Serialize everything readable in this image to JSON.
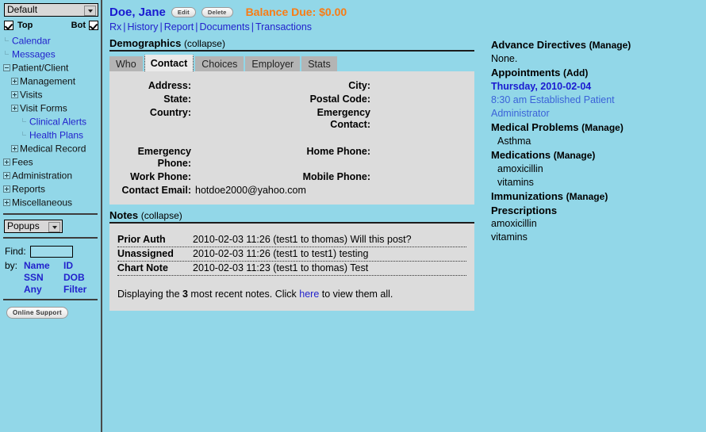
{
  "sidebar": {
    "theme_select": {
      "value": "Default"
    },
    "checkboxes": {
      "top_label": "Top",
      "bot_label": "Bot"
    },
    "nav_items": [
      {
        "label": "Calendar",
        "indent": 0,
        "type": "leaf",
        "link": true
      },
      {
        "label": "Messages",
        "indent": 0,
        "type": "leaf",
        "link": true
      },
      {
        "label": "Patient/Client",
        "indent": 0,
        "type": "minus",
        "link": false
      },
      {
        "label": "Management",
        "indent": 1,
        "type": "plus",
        "link": false
      },
      {
        "label": "Visits",
        "indent": 1,
        "type": "plus",
        "link": false
      },
      {
        "label": "Visit Forms",
        "indent": 1,
        "type": "plus",
        "link": false
      },
      {
        "label": "Clinical Alerts",
        "indent": 2,
        "type": "leaf",
        "link": true
      },
      {
        "label": "Health Plans",
        "indent": 2,
        "type": "leaf",
        "link": true
      },
      {
        "label": "Medical Record",
        "indent": 1,
        "type": "plus",
        "link": false
      },
      {
        "label": "Fees",
        "indent": 0,
        "type": "plus",
        "link": false
      },
      {
        "label": "Administration",
        "indent": 0,
        "type": "plus",
        "link": false
      },
      {
        "label": "Reports",
        "indent": 0,
        "type": "plus",
        "link": false
      },
      {
        "label": "Miscellaneous",
        "indent": 0,
        "type": "plus",
        "link": false
      }
    ],
    "popups_select": {
      "value": "Popups"
    },
    "find": {
      "label": "Find:",
      "value": "",
      "by_label": "by:",
      "options": [
        "Name",
        "ID",
        "SSN",
        "DOB",
        "Any",
        "Filter"
      ]
    },
    "support_button": "Online Support"
  },
  "patient": {
    "name": "Doe, Jane",
    "edit_button": "Edit",
    "delete_button": "Delete",
    "balance_due": "Balance Due: $0.00",
    "links": [
      "Rx",
      "History",
      "Report",
      "Documents",
      "Transactions"
    ]
  },
  "demographics": {
    "title": "Demographics",
    "collapse": "(collapse)",
    "tabs": [
      {
        "label": "Who",
        "active": false
      },
      {
        "label": "Contact",
        "active": true
      },
      {
        "label": "Choices",
        "active": false
      },
      {
        "label": "Employer",
        "active": false
      },
      {
        "label": "Stats",
        "active": false
      }
    ],
    "fields": {
      "address_label": "Address:",
      "address_value": "",
      "city_label": "City:",
      "city_value": "",
      "state_label": "State:",
      "state_value": "",
      "postal_label": "Postal Code:",
      "postal_value": "",
      "country_label": "Country:",
      "country_value": "",
      "emergency_contact_label": "Emergency Contact:",
      "emergency_contact_value": "",
      "emergency_phone_label": "Emergency Phone:",
      "emergency_phone_value": "",
      "home_phone_label": "Home Phone:",
      "home_phone_value": "",
      "work_phone_label": "Work Phone:",
      "work_phone_value": "",
      "mobile_phone_label": "Mobile Phone:",
      "mobile_phone_value": "",
      "contact_email_label": "Contact Email:",
      "contact_email_value": "hotdoe2000@yahoo.com"
    }
  },
  "notes": {
    "title": "Notes",
    "collapse": "(collapse)",
    "rows": [
      {
        "type": "Prior Auth",
        "body": "2010-02-03 11:26 (test1 to thomas) Will this post?"
      },
      {
        "type": "Unassigned",
        "body": "2010-02-03 11:26 (test1 to test1) testing"
      },
      {
        "type": "Chart Note",
        "body": "2010-02-03 11:23 (test1 to thomas) Test"
      }
    ],
    "footer_pre": "Displaying the ",
    "footer_count": "3",
    "footer_mid": " most recent notes. Click ",
    "footer_link": "here",
    "footer_post": " to view them all."
  },
  "summary": {
    "advance_directives": {
      "title": "Advance Directives",
      "action": "(Manage)",
      "value": "None."
    },
    "appointments": {
      "title": "Appointments",
      "action": "(Add)",
      "date": "Thursday, 2010-02-04",
      "time_type": "8:30 am Established Patient",
      "provider": "Administrator"
    },
    "medical_problems": {
      "title": "Medical Problems",
      "action": "(Manage)",
      "items": [
        "Asthma"
      ]
    },
    "medications": {
      "title": "Medications",
      "action": "(Manage)",
      "items": [
        "amoxicillin",
        "vitamins"
      ]
    },
    "immunizations": {
      "title": "Immunizations",
      "action": "(Manage)",
      "items": []
    },
    "prescriptions": {
      "title": "Prescriptions",
      "items": [
        "amoxicillin",
        "vitamins"
      ]
    }
  },
  "colors": {
    "background": "#92d7e8",
    "panel": "#dcdcdc",
    "link": "#2222cc",
    "accent_orange": "#f97c14",
    "tab_inactive": "#b4b4b4"
  }
}
